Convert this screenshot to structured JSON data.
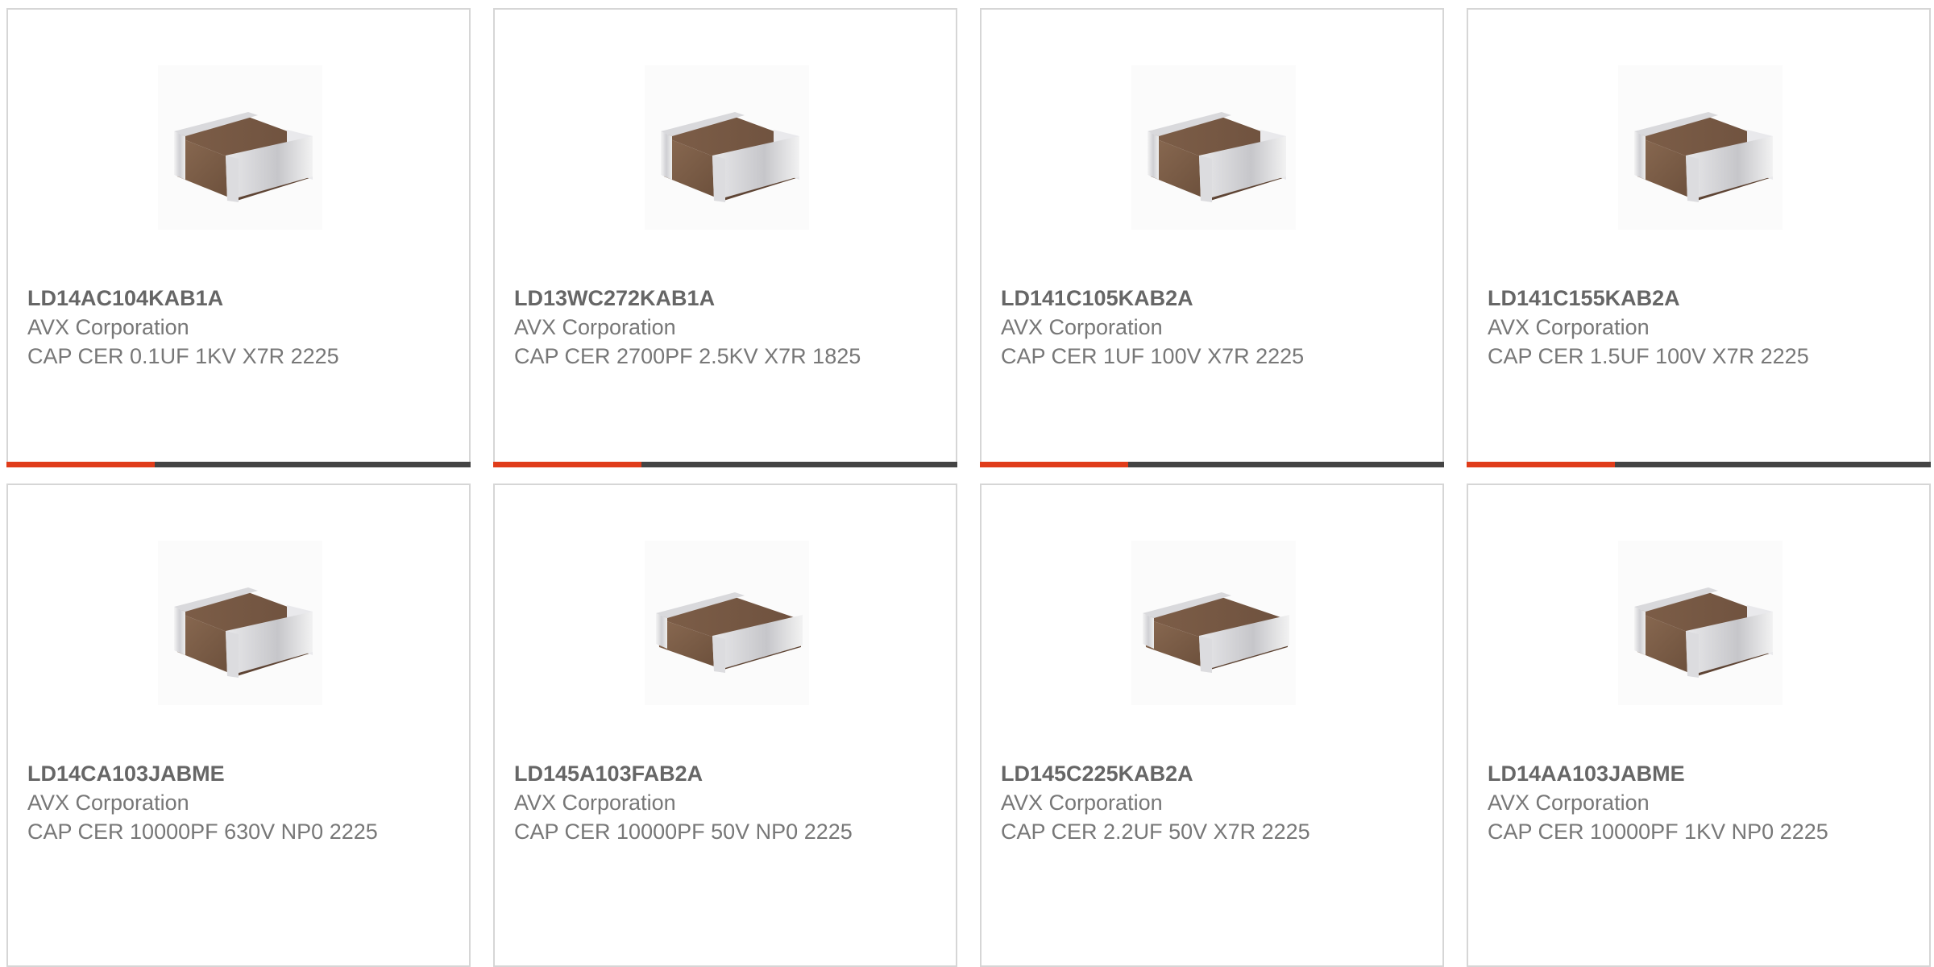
{
  "colors": {
    "accent": "#e03c1a",
    "bar": "#444444",
    "border": "#d6d6d6",
    "text": "#777777",
    "part_number": "#666666"
  },
  "products": [
    {
      "part_number": "LD14AC104KAB1A",
      "manufacturer": "AVX Corporation",
      "description": "CAP CER 0.1UF 1KV X7R 2225",
      "image_icon": "ceramic-capacitor-chip-image"
    },
    {
      "part_number": "LD13WC272KAB1A",
      "manufacturer": "AVX Corporation",
      "description": "CAP CER 2700PF 2.5KV X7R 1825",
      "image_icon": "ceramic-capacitor-chip-image"
    },
    {
      "part_number": "LD141C105KAB2A",
      "manufacturer": "AVX Corporation",
      "description": "CAP CER 1UF 100V X7R 2225",
      "image_icon": "ceramic-capacitor-chip-image"
    },
    {
      "part_number": "LD141C155KAB2A",
      "manufacturer": "AVX Corporation",
      "description": "CAP CER 1.5UF 100V X7R 2225",
      "image_icon": "ceramic-capacitor-chip-image"
    },
    {
      "part_number": "LD14CA103JABME",
      "manufacturer": "AVX Corporation",
      "description": "CAP CER 10000PF 630V NP0 2225",
      "image_icon": "ceramic-capacitor-chip-image"
    },
    {
      "part_number": "LD145A103FAB2A",
      "manufacturer": "AVX Corporation",
      "description": "CAP CER 10000PF 50V NP0 2225",
      "image_icon": "ceramic-capacitor-chip-image"
    },
    {
      "part_number": "LD145C225KAB2A",
      "manufacturer": "AVX Corporation",
      "description": "CAP CER 2.2UF 50V X7R 2225",
      "image_icon": "ceramic-capacitor-chip-image"
    },
    {
      "part_number": "LD14AA103JABME",
      "manufacturer": "AVX Corporation",
      "description": "CAP CER 10000PF 1KV NP0 2225",
      "image_icon": "ceramic-capacitor-chip-image"
    }
  ]
}
